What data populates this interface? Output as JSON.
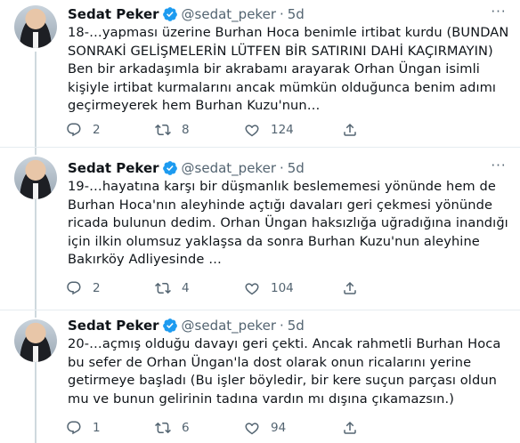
{
  "tweets": [
    {
      "name": "Sedat Peker",
      "handle": "@sedat_peker",
      "separator": "·",
      "time": "5d",
      "text": "18-…yapması üzerine Burhan Hoca benimle irtibat kurdu (BUNDAN\nSONRAKİ GELİŞMELERİN LÜTFEN BİR SATIRINI DAHİ KAÇIRMAYIN)\nBen bir arkadaşımla bir akrabamı arayarak Orhan Üngan isimli\nkişiyle irtibat kurmalarını ancak mümkün olduğunca benim adımı\ngeçirmeyerek hem Burhan Kuzu'nun…",
      "replies": "2",
      "retweets": "8",
      "likes": "124"
    },
    {
      "name": "Sedat Peker",
      "handle": "@sedat_peker",
      "separator": "·",
      "time": "5d",
      "text": "19-…hayatına karşı bir düşmanlık beslememesi yönünde hem de\nBurhan Hoca'nın aleyhinde açtığı davaları geri çekmesi yönünde\nricada bulunun dedim. Orhan Üngan haksızlığa uğradığına inandığı\niçin ilkin olumsuz yaklaşsa da sonra Burhan Kuzu'nun aleyhine\nBakırköy Adliyesinde …",
      "replies": "2",
      "retweets": "4",
      "likes": "104"
    },
    {
      "name": "Sedat Peker",
      "handle": "@sedat_peker",
      "separator": "·",
      "time": "5d",
      "text": "20-…açmış olduğu davayı geri çekti. Ancak rahmetli Burhan Hoca\nbu sefer de Orhan Üngan'la dost olarak onun ricalarını yerine\ngetirmeye başladı (Bu işler böyledir, bir kere suçun parçası oldun\nmu ve bunun gelirinin tadına vardın mı dışına çıkamazsın.)",
      "replies": "1",
      "retweets": "6",
      "likes": "94"
    }
  ],
  "icons": {
    "verified": "verified-badge-icon",
    "more": "more-options-icon",
    "reply": "reply-icon",
    "retweet": "retweet-icon",
    "like": "heart-icon",
    "share": "share-icon"
  },
  "colors": {
    "verified": "#1d9bf0",
    "secondary_text": "#536471",
    "primary_text": "#0f1419",
    "thread_line": "#cfd9de",
    "divider": "#e6ecf0"
  }
}
